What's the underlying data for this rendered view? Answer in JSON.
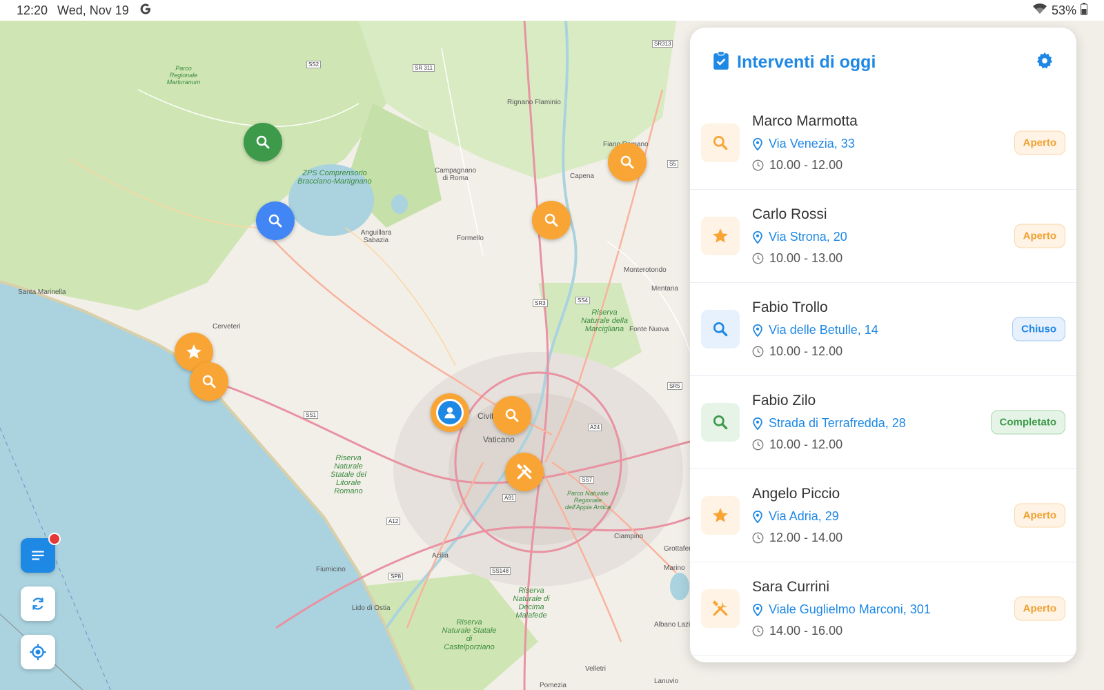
{
  "status_bar": {
    "time": "12:20",
    "date": "Wed, Nov 19",
    "google_icon": "google-icon",
    "wifi_icon": "wifi-icon",
    "battery": "53%"
  },
  "colors": {
    "primary": "#1e88e5",
    "orange": "#f9a535",
    "green": "#3c9a4a",
    "blue": "#4285f4",
    "notification": "#e53935"
  },
  "map": {
    "labels": [
      "ZPS Comprensorio Bracciano-Martignano",
      "Santa Marinella",
      "Cerveteri",
      "Anguillara Sabazia",
      "Formello",
      "Campagnano di Roma",
      "Rignano Flaminio",
      "Capena",
      "Fiano Romano",
      "Monterotondo",
      "Mentana",
      "Fonte Nuova",
      "Riserva Naturale della Marcigliana",
      "Riserva Naturale Statale del Litorale Romano",
      "Fiumicino",
      "Acilia",
      "Lido di Ostia",
      "Ciampino",
      "Grottaferrata",
      "Albano Laziale",
      "Marino",
      "Velletri",
      "Lanuvio",
      "Pomezia",
      "Parco Naturale Regionale dell'Appia Antica",
      "Riserva Naturale di Decima Malafede",
      "Riserva Naturale Statale di Castelporziano",
      "Parco Regionale Marturanum",
      "Civita",
      "Vaticano"
    ],
    "roads": [
      "SS2",
      "SR 311",
      "SR313",
      "S5",
      "SR3",
      "SS4",
      "SS1",
      "A12",
      "A91",
      "SS148",
      "SP8",
      "A24",
      "SS7",
      "SR5"
    ],
    "pins": [
      {
        "type": "green",
        "icon": "search-icon"
      },
      {
        "type": "blue",
        "icon": "search-icon"
      },
      {
        "type": "orange",
        "icon": "search-icon"
      },
      {
        "type": "orange",
        "icon": "search-icon"
      },
      {
        "type": "orange",
        "icon": "star-icon"
      },
      {
        "type": "orange",
        "icon": "search-icon"
      },
      {
        "type": "user",
        "icon": "user-location-icon"
      },
      {
        "type": "orange",
        "icon": "search-icon"
      },
      {
        "type": "orange",
        "icon": "tools-icon"
      }
    ]
  },
  "fabs": {
    "list_icon": "list-icon",
    "refresh_icon": "refresh-icon",
    "locate_icon": "my-location-icon"
  },
  "panel": {
    "title": "Interventi di oggi",
    "title_icon": "clipboard-check-icon",
    "settings_icon": "gear-icon",
    "items": [
      {
        "name": "Marco Marmotta",
        "address": "Via Venezia, 33",
        "time": "10.00 - 12.00",
        "status": "Aperto",
        "icon": "search-icon",
        "color": "orange"
      },
      {
        "name": "Carlo Rossi",
        "address": "Via Strona, 20",
        "time": "10.00 - 13.00",
        "status": "Aperto",
        "icon": "star-icon",
        "color": "orange"
      },
      {
        "name": "Fabio Trollo",
        "address": "Via delle Betulle, 14",
        "time": "10.00 - 12.00",
        "status": "Chiuso",
        "icon": "search-icon",
        "color": "blue"
      },
      {
        "name": "Fabio Zilo",
        "address": "Strada di Terrafredda, 28",
        "time": "10.00 - 12.00",
        "status": "Completato",
        "icon": "search-icon",
        "color": "green"
      },
      {
        "name": "Angelo Piccio",
        "address": "Via Adria, 29",
        "time": "12.00 - 14.00",
        "status": "Aperto",
        "icon": "star-icon",
        "color": "orange"
      },
      {
        "name": "Sara Currini",
        "address": "Viale Guglielmo Marconi, 301",
        "time": "14.00 - 16.00",
        "status": "Aperto",
        "icon": "tools-icon",
        "color": "orange"
      }
    ]
  }
}
